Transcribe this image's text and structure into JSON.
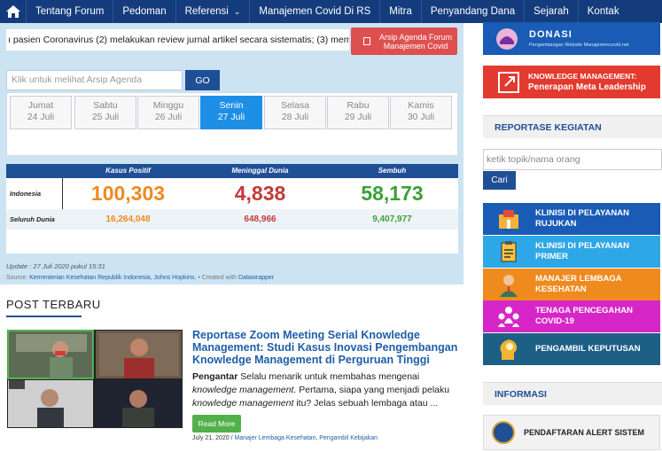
{
  "nav": {
    "home_icon": "home-icon",
    "items": [
      "Tentang Forum",
      "Pedoman",
      "Referensi",
      "Manajemen Covid Di RS",
      "Mitra",
      "Penyandang Dana",
      "Sejarah",
      "Kontak"
    ]
  },
  "ticker": "ı pasien Coronavirus (2) melakukan review jurnal artikel secara sistematis; (3) membahas ke",
  "arsip_button": "Arsip Agenda Forum Manajemen Covid",
  "agenda_search": {
    "placeholder": "Klik untuk melihat Arsip Agenda",
    "go_label": "GO"
  },
  "days": [
    {
      "day": "Jumat",
      "date": "24 Juli"
    },
    {
      "day": "Sabtu",
      "date": "25 Juli"
    },
    {
      "day": "Minggu",
      "date": "26 Juli"
    },
    {
      "day": "Senin",
      "date": "27 Juli",
      "active": true
    },
    {
      "day": "Selasa",
      "date": "28 Juli"
    },
    {
      "day": "Rabu",
      "date": "29 Juli"
    },
    {
      "day": "Kamis",
      "date": "30 Juli"
    }
  ],
  "covid": {
    "headers": [
      "Kasus Positif",
      "Meninggal Dunia",
      "Sembuh"
    ],
    "rows": [
      {
        "label": "Indonesia",
        "positif": "100,303",
        "meninggal": "4,838",
        "sembuh": "58,173"
      },
      {
        "label": "Seluruh Dunia",
        "positif": "16,264,048",
        "meninggal": "648,966",
        "sembuh": "9,407,977"
      }
    ],
    "update": "Update : 27 Juli 2020 pukul 15:31",
    "source_prefix": "Source:",
    "source_links": "Kementerian Kesehatan Republik Indonesia, Johns Hopkins.",
    "created_prefix": "• Created with",
    "created_link": "Datawrapper",
    "colors": {
      "positif": "#ee8a20",
      "meninggal": "#c43a3a",
      "sembuh": "#3aa03a"
    }
  },
  "post": {
    "section_title": "POST TERBARU",
    "title": "Reportase Zoom Meeting Serial Knowledge Management: Studi Kasus Inovasi Pengembangan Knowledge Management di Perguruan Tinggi",
    "body_lead": "Pengantar",
    "body_1": " Selalu menarik untuk membahas mengenai ",
    "body_em1": "knowledge management",
    "body_2": ". Pertama, siapa yang menjadi pelaku ",
    "body_em2": "knowledge management",
    "body_3": " itu? Jelas sebuah lembaga atau ...",
    "read_more": "Read More",
    "date": "July 21, 2020",
    "sep": " / ",
    "cat1": "Manajer Lembaga Kesehatan",
    "cat2": "Pengambil Kebijakan"
  },
  "sidebar": {
    "donasi_title": "DONASI",
    "donasi_sub": "Pengembangan Website Manajemencovid.net",
    "km_line1": "KNOWLEDGE MANAGEMENT:",
    "km_line2": "Penerapan Meta Leadership",
    "reportase_head": "REPORTASE KEGIATAN",
    "search_placeholder": "ketik topik/nama orang",
    "cari_label": "Cari",
    "categories": [
      {
        "label": "KLINISI DI PELAYANAN RUJUKAN",
        "color": "#1a5bb5",
        "icon": "hospital-icon"
      },
      {
        "label": "KLINISI DI PELAYANAN PRIMER",
        "color": "#2ea7e6",
        "icon": "clipboard-icon"
      },
      {
        "label": "MANAJER LEMBAGA KESEHATAN",
        "color": "#ef8a1e",
        "icon": "manager-icon"
      },
      {
        "label": "TENAGA PENCEGAHAN COVID-19",
        "color": "#d726c7",
        "icon": "team-icon"
      },
      {
        "label": "PENGAMBIL KEPUTUSAN",
        "color": "#1e5f86",
        "icon": "head-bulb-icon"
      }
    ],
    "informasi_head": "INFORMASI",
    "alert_label": "PENDAFTARAN ALERT SISTEM"
  }
}
